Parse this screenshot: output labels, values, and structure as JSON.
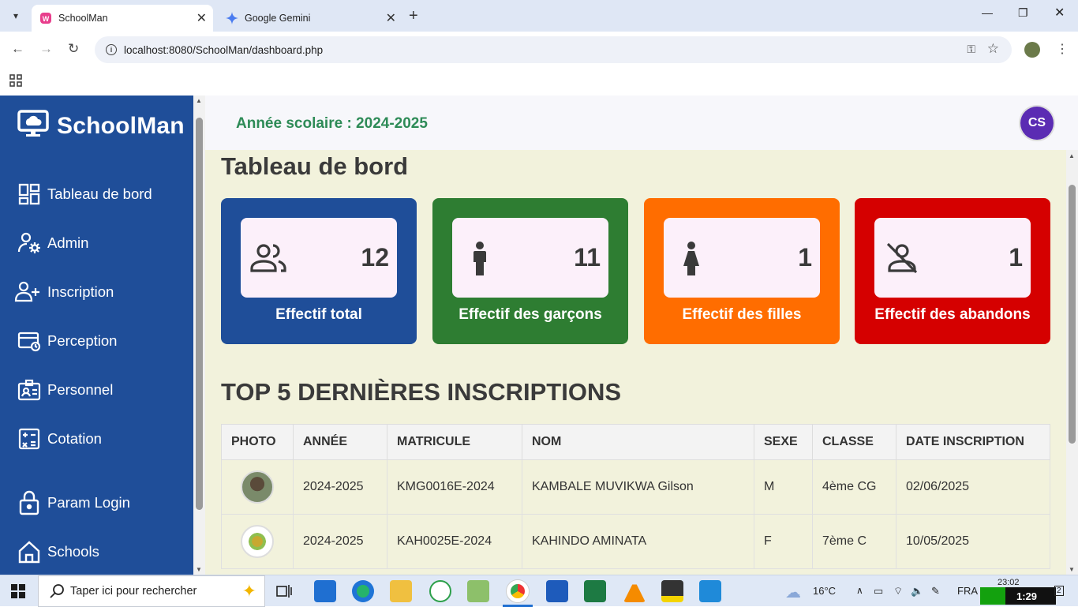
{
  "browser": {
    "tabs": [
      {
        "title": "SchoolMan",
        "active": true
      },
      {
        "title": "Google Gemini",
        "active": false
      }
    ],
    "url": "localhost:8080/SchoolMan/dashboard.php"
  },
  "sidebar": {
    "brand": "SchoolMan",
    "items": [
      {
        "label": "Tableau de bord",
        "icon": "dashboard-icon"
      },
      {
        "label": "Admin",
        "icon": "admin-gear-icon"
      },
      {
        "label": "Inscription",
        "icon": "add-user-icon"
      },
      {
        "label": "Perception",
        "icon": "payment-card-icon"
      },
      {
        "label": "Personnel",
        "icon": "badge-icon"
      },
      {
        "label": "Cotation",
        "icon": "calculator-icon"
      },
      {
        "label": "Param Login",
        "icon": "lock-icon"
      },
      {
        "label": "Schools",
        "icon": "home-icon"
      }
    ]
  },
  "header": {
    "year": "Année scolaire : 2024-2025",
    "avatar": "CS"
  },
  "main": {
    "title": "Tableau de bord",
    "cards": [
      {
        "value": "12",
        "label": "Effectif total",
        "color": "#1f4e99",
        "icon": "group-icon"
      },
      {
        "value": "11",
        "label": "Effectif des garçons",
        "color": "#2e7d32",
        "icon": "male-icon"
      },
      {
        "value": "1",
        "label": "Effectif des filles",
        "color": "#ff6d00",
        "icon": "female-icon"
      },
      {
        "value": "1",
        "label": "Effectif des abandons",
        "color": "#d50000",
        "icon": "person-off-icon"
      }
    ],
    "section_title": "TOP 5 DERNIÈRES INSCRIPTIONS",
    "table": {
      "columns": [
        "PHOTO",
        "ANNÉE",
        "MATRICULE",
        "NOM",
        "SEXE",
        "CLASSE",
        "DATE INSCRIPTION"
      ],
      "rows": [
        {
          "annee": "2024-2025",
          "matricule": "KMG0016E-2024",
          "nom": "KAMBALE MUVIKWA Gilson",
          "sexe": "M",
          "classe": "4ème CG",
          "date": "02/06/2025"
        },
        {
          "annee": "2024-2025",
          "matricule": "KAH0025E-2024",
          "nom": "KAHINDO AMINATA",
          "sexe": "F",
          "classe": "7ème C",
          "date": "10/05/2025"
        }
      ]
    }
  },
  "taskbar": {
    "search_placeholder": "Taper ici pour rechercher",
    "weather": "16°C",
    "lang": "FRA",
    "time": "23:02",
    "battery_time": "1:29",
    "notif_count": "2"
  }
}
